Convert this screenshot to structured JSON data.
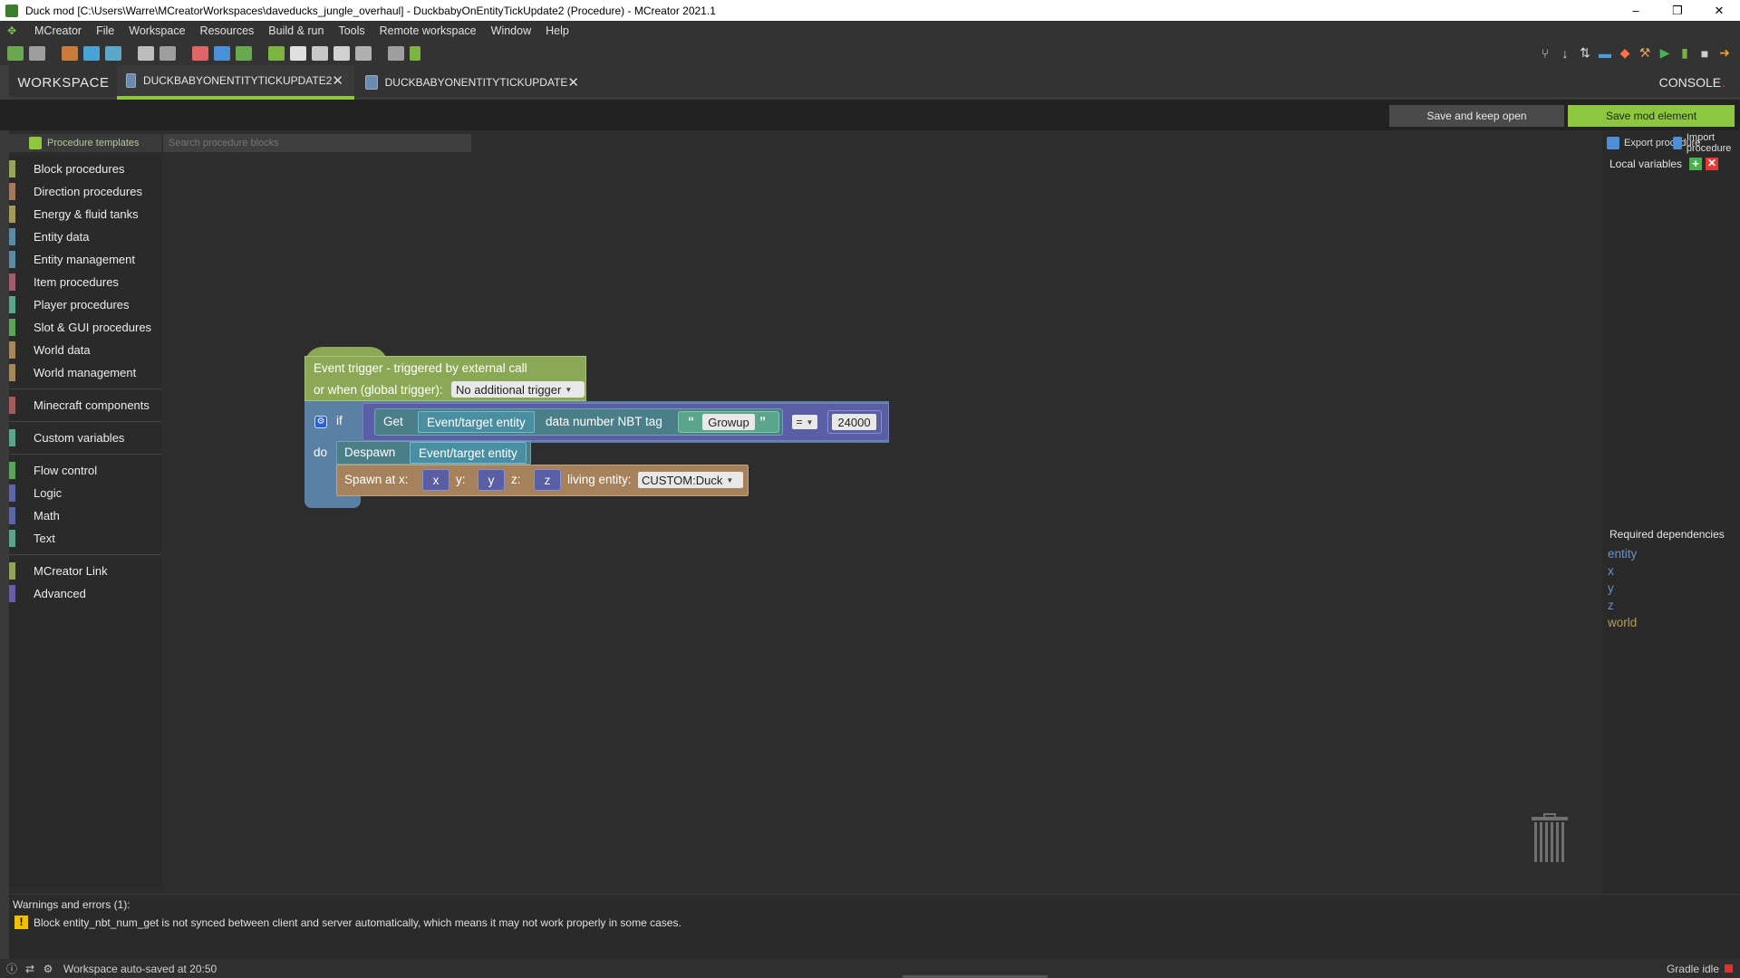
{
  "titlebar": {
    "title": "Duck mod [C:\\Users\\Warre\\MCreatorWorkspaces\\daveducks_jungle_overhaul] - DuckbabyOnEntityTickUpdate2 (Procedure) - MCreator 2021.1",
    "minimize": "–",
    "restore": "❐",
    "close": "✕"
  },
  "menubar": {
    "items": [
      "MCreator",
      "File",
      "Workspace",
      "Resources",
      "Build & run",
      "Tools",
      "Remote workspace",
      "Window",
      "Help"
    ]
  },
  "tabs": {
    "workspace": "WORKSPACE",
    "tab1": "DUCKBABYONENTITYTICKUPDATE2",
    "tab2": "DUCKBABYONENTITYTICKUPDATE",
    "console": "CONSOLE",
    "console_dot": "."
  },
  "actions": {
    "save_keep_open": "Save and keep open",
    "save_mod_element": "Save mod element"
  },
  "palette": {
    "templates_label": "Procedure templates",
    "search_placeholder": "Search procedure blocks",
    "groups": [
      {
        "label": "Block procedures",
        "color": "#9aa35a"
      },
      {
        "label": "Direction procedures",
        "color": "#a5795b"
      },
      {
        "label": "Energy & fluid tanks",
        "color": "#a5985b"
      },
      {
        "label": "Entity data",
        "color": "#5b8aa5"
      },
      {
        "label": "Entity management",
        "color": "#5b8aa5"
      },
      {
        "label": "Item procedures",
        "color": "#a55b6e"
      },
      {
        "label": "Player procedures",
        "color": "#5ba58c"
      },
      {
        "label": "Slot & GUI procedures",
        "color": "#5ba55b"
      },
      {
        "label": "World data",
        "color": "#a5875b"
      },
      {
        "label": "World management",
        "color": "#a5875b"
      },
      {
        "label": "Minecraft components",
        "color": "#a55b5b"
      },
      {
        "label": "Custom variables",
        "color": "#5ba58c"
      },
      {
        "label": "Flow control",
        "color": "#5ba55b"
      },
      {
        "label": "Logic",
        "color": "#5b67a5"
      },
      {
        "label": "Math",
        "color": "#5b67a5"
      },
      {
        "label": "Text",
        "color": "#5ba58c"
      },
      {
        "label": "MCreator Link",
        "color": "#8fa55b"
      },
      {
        "label": "Advanced",
        "color": "#6c5ba5"
      }
    ]
  },
  "blocks": {
    "event_line1": "Event trigger - triggered by external call",
    "event_line2": "or when (global trigger):",
    "event_trigger_value": "No additional trigger",
    "if": "if",
    "do": "do",
    "get": "Get",
    "event_entity": "Event/target entity",
    "nbt_label": "data number NBT tag",
    "open_quote": "“",
    "close_quote": "”",
    "nbt_tag": "Growup",
    "compare_op": "=",
    "compare_value": "24000",
    "despawn": "Despawn",
    "spawn_at_x": "Spawn at x:",
    "y_label": "y:",
    "z_label": "z:",
    "var_x": "x",
    "var_y": "y",
    "var_z": "z",
    "living_entity": "living entity:",
    "entity_value": "CUSTOM:Duck"
  },
  "rightpanel": {
    "export": "Export procedure",
    "import": "Import procedure",
    "local_vars": "Local variables",
    "add": "+",
    "remove": "✕",
    "required_title": "Required dependencies",
    "dependencies": [
      "entity",
      "x",
      "y",
      "z",
      "world"
    ]
  },
  "warnings": {
    "title": "Warnings and errors (1):",
    "icon": "!",
    "message": "Block entity_nbt_num_get is not synced between client and server automatically, which means it may not work properly in some cases."
  },
  "statusbar": {
    "text": "Workspace auto-saved at 20:50",
    "gradle": "Gradle idle"
  }
}
